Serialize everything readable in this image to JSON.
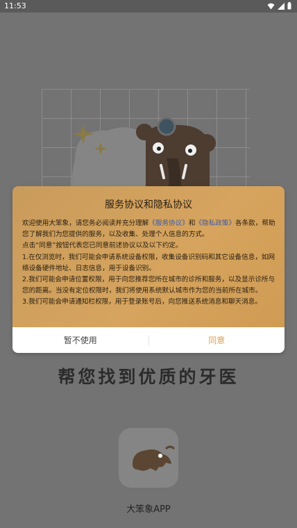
{
  "status_bar": {
    "time": "11:53"
  },
  "splash": {
    "slogan": "帮您找到优质的牙医",
    "app_name": "大笨象APP"
  },
  "dialog": {
    "title": "服务协议和隐私协议",
    "intro_1": "欢迎使用大笨象，请您务必阅读并充分理解",
    "link_service": "《服务协议》",
    "and": "和",
    "link_privacy": "《隐私政策》",
    "intro_2": "各条款，帮助您了解我们为您提供的服务，以及收集、处理个人信息的方式。",
    "para_2": "点击“同意”按钮代表您已同意前述协议以及以下约定。",
    "para_3": "1.在仅浏览时，我们可能会申请系统设备权限，收集设备识别码和其它设备信息，如网络设备硬件地址、日志信息，用于设备识别。",
    "para_4": "2.我们可能会申请位置权限，用于向您推荐您所在城市的诊所和服务，以及显示诊所与您的距离。当没有定位权限时，我们将使用系统默认城市作为您的当前所在城市。",
    "para_5": "3.我们可能会申请通知栏权限，用于登录账号后，向您推送系统消息和聊天消息。",
    "decline_label": "暂不使用",
    "agree_label": "同意"
  },
  "colors": {
    "accent": "#d4a056",
    "link": "#3c5aa8"
  }
}
